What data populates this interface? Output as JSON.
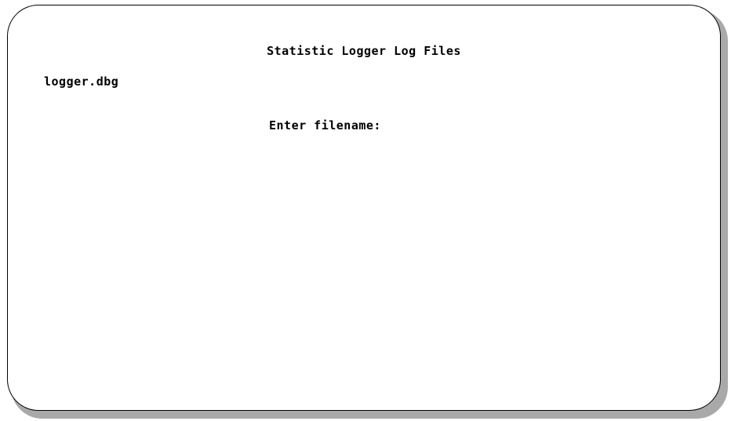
{
  "screen": {
    "title": "Statistic Logger Log Files",
    "current_file": "logger.dbg",
    "prompt_label": "Enter filename:",
    "prompt_value": ""
  },
  "colors": {
    "background": "#ffffff",
    "text": "#000000",
    "frame_border": "#000000",
    "shadow": "#a9a9a9"
  }
}
